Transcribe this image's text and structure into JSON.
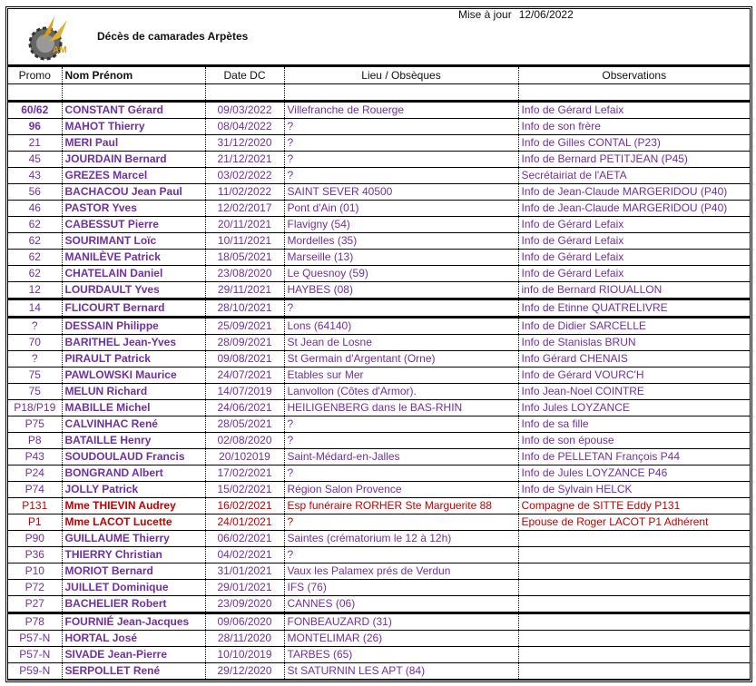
{
  "header": {
    "title": "Décès de camarades Arpètes",
    "update_label": "Mise à jour",
    "update_date": "12/06/2022",
    "logo_text": "AM"
  },
  "columns": [
    "Promo",
    "Nom Prénom",
    "Date DC",
    "Lieu / Obsèques",
    "Observations"
  ],
  "colors": {
    "purple": "#7030a0",
    "red": "#c00000"
  },
  "rows": [
    {
      "promo": "60/62",
      "nom": "CONSTANT Gérard",
      "date": "09/03/2022",
      "lieu": "Villefranche de Rouerge",
      "obs": "Info de Gérard Lefaix",
      "color": "purple",
      "promo_bold": true
    },
    {
      "promo": "96",
      "nom": "MAHOT Thierry",
      "date": "08/04/2022",
      "lieu": "?",
      "obs": "Info de son frère",
      "color": "purple",
      "promo_bold": true
    },
    {
      "promo": "21",
      "nom": "MERI Paul",
      "date": "31/12/2020",
      "lieu": "?",
      "obs": "Info de Gilles CONTAL (P23)",
      "color": "purple"
    },
    {
      "promo": "45",
      "nom": "JOURDAIN Bernard",
      "date": "21/12/2021",
      "lieu": "?",
      "obs": "Info de Bernard PETITJEAN (P45)",
      "color": "purple"
    },
    {
      "promo": "43",
      "nom": "GREZES Marcel",
      "date": "03/02/2022",
      "lieu": "?",
      "obs": "Secrétairiat de l'AETA",
      "color": "purple"
    },
    {
      "promo": "56",
      "nom": "BACHACOU Jean Paul",
      "date": "11/02/2022",
      "lieu": "SAINT SEVER 40500",
      "obs": "Info de Jean-Claude MARGERIDOU (P40)",
      "color": "purple"
    },
    {
      "promo": "46",
      "nom": "PASTOR Yves",
      "date": "12/02/2017",
      "lieu": "Pont d'Ain (01)",
      "obs": "Info de Jean-Claude MARGERIDOU (P40)",
      "color": "purple"
    },
    {
      "promo": "62",
      "nom": "CABESSUT Pierre",
      "date": "20/11/2021",
      "lieu": "Flavigny (54)",
      "obs": "Info de Gérard Lefaix",
      "color": "purple"
    },
    {
      "promo": "62",
      "nom": "SOURIMANT Loïc",
      "date": "10/11/2021",
      "lieu": "Mordelles (35)",
      "obs": "Info de Gérard Lefaix",
      "color": "purple"
    },
    {
      "promo": "62",
      "nom": "MANILÈVE Patrick",
      "date": "18/05/2021",
      "lieu": "Marseille (13)",
      "obs": "Info de Gérard Lefaix",
      "color": "purple"
    },
    {
      "promo": "62",
      "nom": "CHATELAIN Daniel",
      "date": "23/08/2020",
      "lieu": "Le Quesnoy (59)",
      "obs": "Info de Gérard Lefaix",
      "color": "purple"
    },
    {
      "promo": "12",
      "nom": "LOURDAULT Yves",
      "date": "29/11/2021",
      "lieu": "HAYBES (08)",
      "obs": "info de Bernard RIOUALLON",
      "color": "purple",
      "thick": true
    },
    {
      "promo": "14",
      "nom": "FLICOURT Bernard",
      "date": "28/10/2021",
      "lieu": "?",
      "obs": "Info de Etinne QUATRELIVRE",
      "color": "purple",
      "thick": true
    },
    {
      "promo": "?",
      "nom": "DESSAIN Philippe",
      "date": "25/09/2021",
      "lieu": "Lons (64140)",
      "obs": "Info de Didier SARCELLE",
      "color": "purple"
    },
    {
      "promo": "70",
      "nom": "BARITHEL Jean-Yves",
      "date": "28/09/2021",
      "lieu": "St Jean de  Losne",
      "obs": "Info de Stanislas BRUN",
      "color": "purple"
    },
    {
      "promo": "?",
      "nom": "PIRAULT Patrick",
      "date": "09/08/2021",
      "lieu": "St Germain d'Argentant (Orne)",
      "obs": "Info Gérard CHENAIS",
      "color": "purple"
    },
    {
      "promo": "75",
      "nom": "PAWLOWSKI Maurice",
      "date": "24/07/2021",
      "lieu": "Etables sur Mer",
      "obs": "Info de Gérard VOURC'H",
      "color": "purple"
    },
    {
      "promo": "75",
      "nom": "MELUN Richard",
      "date": "14/07/2019",
      "lieu": "Lanvollon (Côtes d'Armor).",
      "obs": "Info Jean-Noel COINTRE",
      "color": "purple"
    },
    {
      "promo": "P18/P19",
      "nom": "MABILLE Michel",
      "date": "24/06/2021",
      "lieu": "HEILIGENBERG dans le BAS-RHIN",
      "obs": "Info Jules LOYZANCE",
      "color": "purple"
    },
    {
      "promo": "P75",
      "nom": "CALVINHAC René",
      "date": "28/05/2021",
      "lieu": "?",
      "obs": "Info de sa fille",
      "color": "purple"
    },
    {
      "promo": "P8",
      "nom": "BATAILLE Henry",
      "date": "02/08/2020",
      "lieu": "?",
      "obs": "Info de son épouse",
      "color": "purple"
    },
    {
      "promo": "P43",
      "nom": "SOUDOULAUD Francis",
      "date": "20/102019",
      "lieu": "Saint-Médard-en-Jalles",
      "obs": "Info de PELLETAN François  P44",
      "color": "purple"
    },
    {
      "promo": "P24",
      "nom": "BONGRAND Albert",
      "date": "17/02/2021",
      "lieu": "?",
      "obs": "Info de Jules LOYZANCE P46",
      "color": "purple"
    },
    {
      "promo": "P74",
      "nom": "JOLLY Patrick",
      "date": "15/02/2021",
      "lieu": "Région Salon Provence",
      "obs": "Info de Sylvain HELCK",
      "color": "purple"
    },
    {
      "promo": "P131",
      "nom": "Mme THIEVIN Audrey",
      "date": "16/02/2021",
      "lieu": "Esp funéraire RORHER Ste Marguerite 88",
      "obs": "Compagne de SITTE Eddy P131",
      "color": "red"
    },
    {
      "promo": "P1",
      "nom": "Mme LACOT Lucette",
      "date": "24/01/2021",
      "lieu": "?",
      "obs": "Epouse de Roger LACOT P1 Adhérent",
      "color": "red"
    },
    {
      "promo": "P90",
      "nom": "GUILLAUME Thierry",
      "date": "06/02/2021",
      "lieu": "Saintes (crématorium le 12 à 12h)",
      "obs": "",
      "color": "purple"
    },
    {
      "promo": "P36",
      "nom": "THIERRY Christian",
      "date": "04/02/2021",
      "lieu": "?",
      "obs": "",
      "color": "purple"
    },
    {
      "promo": "P10",
      "nom": "MORIOT Bernard",
      "date": "31/01/2021",
      "lieu": "Vaux les Palamex prés de Verdun",
      "obs": "",
      "color": "purple"
    },
    {
      "promo": "P72",
      "nom": "JUILLET Dominique",
      "date": "29/01/2021",
      "lieu": "IFS (76)",
      "obs": "",
      "color": "purple"
    },
    {
      "promo": "P27",
      "nom": "BACHELIER Robert",
      "date": "23/09/2020",
      "lieu": "CANNES (06)",
      "obs": "",
      "color": "purple",
      "thick": true
    },
    {
      "promo": "P78",
      "nom": "FOURNIÉ Jean-Jacques",
      "date": "09/06/2020",
      "lieu": "FONBEAUZARD (31)",
      "obs": "",
      "color": "purple"
    },
    {
      "promo": "P57-N",
      "nom": "HORTAL José",
      "date": "28/11/2020",
      "lieu": "MONTELIMAR (26)",
      "obs": "",
      "color": "purple"
    },
    {
      "promo": "P57-N",
      "nom": "SIVADE Jean-Pierre",
      "date": "10/10/2019",
      "lieu": "TARBES (65)",
      "obs": "",
      "color": "purple"
    },
    {
      "promo": "P59-N",
      "nom": "SERPOLLET René",
      "date": "29/12/2020",
      "lieu": "St SATURNIN LES APT  (84)",
      "obs": "",
      "color": "purple"
    }
  ]
}
